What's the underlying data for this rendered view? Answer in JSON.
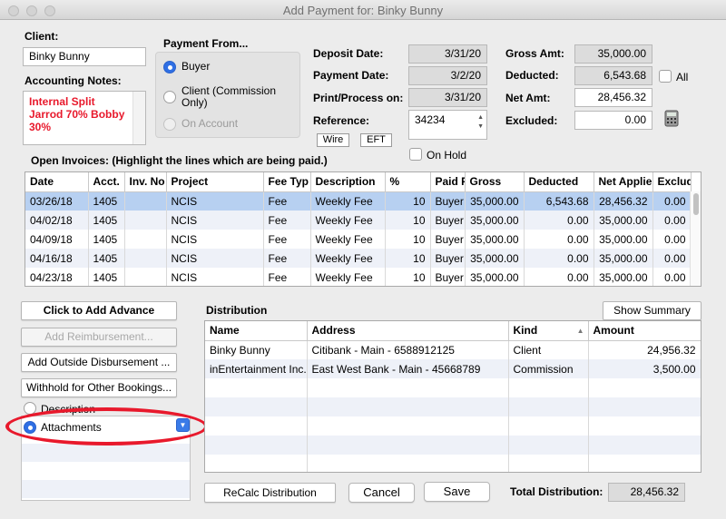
{
  "window": {
    "title": "Add Payment for: Binky Bunny"
  },
  "client": {
    "label": "Client:",
    "value": "Binky Bunny"
  },
  "notes": {
    "label": "Accounting Notes:",
    "text": "Internal Split Jarrod 70% Bobby 30%",
    "color": "#e8192c"
  },
  "payment_from": {
    "label": "Payment From...",
    "options": [
      "Buyer",
      "Client (Commission Only)",
      "On Account"
    ],
    "selected": "Buyer"
  },
  "dates": {
    "deposit_label": "Deposit Date:",
    "deposit_value": "3/31/20",
    "payment_label": "Payment Date:",
    "payment_value": "3/2/20",
    "print_label": "Print/Process on:",
    "print_value": "3/31/20",
    "reference_label": "Reference:",
    "reference_value": "34234",
    "wire_label": "Wire",
    "eft_label": "EFT",
    "onhold_label": "On Hold"
  },
  "amounts": {
    "gross_label": "Gross Amt:",
    "gross_value": "35,000.00",
    "deducted_label": "Deducted:",
    "deducted_value": "6,543.68",
    "all_label": "All",
    "net_label": "Net Amt:",
    "net_value": "28,456.32",
    "excluded_label": "Excluded:",
    "excluded_value": "0.00"
  },
  "invoices": {
    "label": "Open Invoices: (Highlight the lines which are being paid.)",
    "columns": [
      "Date",
      "Acct.",
      "Inv. No",
      "Project",
      "Fee Typ",
      "Description",
      "%",
      "Paid Fr",
      "Gross",
      "Deducted",
      "Net Applie",
      "Exclude"
    ],
    "rows": [
      [
        "03/26/18",
        "1405",
        "",
        "NCIS",
        "Fee",
        "Weekly Fee",
        "10",
        "Buyer",
        "35,000.00",
        "6,543.68",
        "28,456.32",
        "0.00"
      ],
      [
        "04/02/18",
        "1405",
        "",
        "NCIS",
        "Fee",
        "Weekly Fee",
        "10",
        "Buyer",
        "35,000.00",
        "0.00",
        "35,000.00",
        "0.00"
      ],
      [
        "04/09/18",
        "1405",
        "",
        "NCIS",
        "Fee",
        "Weekly Fee",
        "10",
        "Buyer",
        "35,000.00",
        "0.00",
        "35,000.00",
        "0.00"
      ],
      [
        "04/16/18",
        "1405",
        "",
        "NCIS",
        "Fee",
        "Weekly Fee",
        "10",
        "Buyer",
        "35,000.00",
        "0.00",
        "35,000.00",
        "0.00"
      ],
      [
        "04/23/18",
        "1405",
        "",
        "NCIS",
        "Fee",
        "Weekly Fee",
        "10",
        "Buyer",
        "35,000.00",
        "0.00",
        "35,000.00",
        "0.00"
      ]
    ]
  },
  "left_buttons": {
    "advance": "Click to Add Advance",
    "reimbursement": "Add Reimbursement...",
    "outside": "Add Outside Disbursement ...",
    "withhold": "Withhold for Other Bookings...",
    "description": "Description",
    "attachments": "Attachments"
  },
  "distribution": {
    "label": "Distribution",
    "show_summary": "Show Summary",
    "columns": [
      "Name",
      "Address",
      "Kind",
      "Amount"
    ],
    "rows": [
      [
        "Binky Bunny",
        "Citibank - Main - 6588912125",
        "Client",
        "24,956.32"
      ],
      [
        "inEntertainment Inc.",
        "East West Bank - Main - 45668789",
        "Commission",
        "3,500.00"
      ]
    ]
  },
  "footer": {
    "recalc": "ReCalc Distribution",
    "cancel": "Cancel",
    "save": "Save",
    "total_label": "Total Distribution:",
    "total_value": "28,456.32"
  },
  "colors": {
    "accent": "#2f6fe4",
    "selection": "#b7d0f1",
    "annotation": "#e8192c"
  }
}
